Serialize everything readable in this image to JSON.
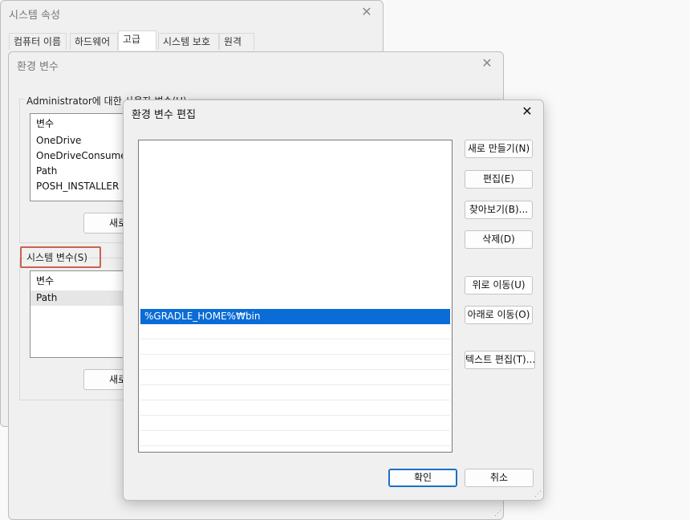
{
  "system_properties": {
    "title": "시스템 속성",
    "tabs": [
      "컴퓨터 이름",
      "하드웨어",
      "고급",
      "시스템 보호",
      "원격"
    ]
  },
  "env_vars": {
    "title": "환경 변수",
    "user_group_label": "Administrator에 대한 사용자 변수(U)",
    "user_list_header": "변수",
    "user_vars": [
      "OneDrive",
      "OneDriveConsumer",
      "Path",
      "POSH_INSTALLER"
    ],
    "user_new_button": "새로",
    "system_group_label": "시스템 변수(S)",
    "system_list_header": "변수",
    "system_vars": [
      "Path"
    ],
    "system_new_button": "새로"
  },
  "edit_dialog": {
    "title": "환경 변수 편집",
    "entries": [
      "%GRADLE_HOME%₩bin"
    ],
    "buttons": {
      "new": "새로 만들기(N)",
      "edit": "편집(E)",
      "browse": "찾아보기(B)...",
      "delete": "삭제(D)",
      "move_up": "위로 이동(U)",
      "move_down": "아래로 이동(O)",
      "edit_text": "텍스트 편집(T)...",
      "ok": "확인",
      "cancel": "취소"
    }
  },
  "colors": {
    "selection": "#0a6cd6",
    "highlight_box": "#c9624f"
  }
}
